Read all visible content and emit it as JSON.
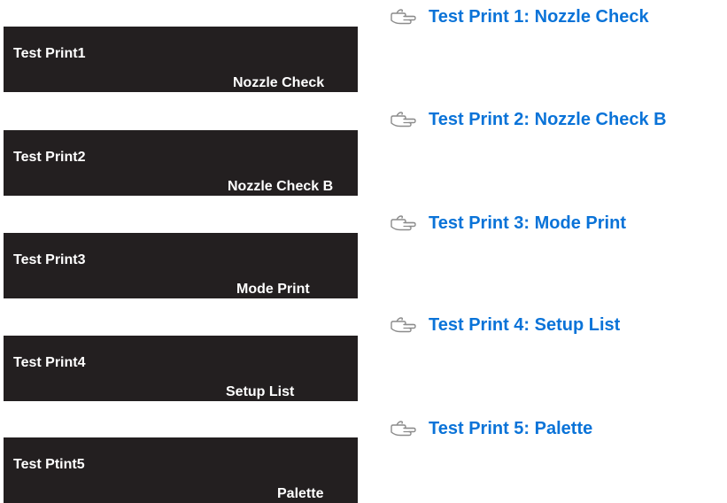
{
  "panels": [
    {
      "title": "Test Print1",
      "value": "Nozzle Check"
    },
    {
      "title": "Test Print2",
      "value": "Nozzle Check B"
    },
    {
      "title": "Test Print3",
      "value": "Mode Print"
    },
    {
      "title": "Test Print4",
      "value": "Setup List"
    },
    {
      "title": "Test Ptint5",
      "value": "Palette"
    }
  ],
  "links": [
    {
      "icon": "pointing-hand-icon",
      "label": "Test Print 1: Nozzle Check"
    },
    {
      "icon": "pointing-hand-icon",
      "label": "Test Print 2: Nozzle Check B"
    },
    {
      "icon": "pointing-hand-icon",
      "label": "Test Print 3: Mode Print"
    },
    {
      "icon": "pointing-hand-icon",
      "label": "Test Print 4: Setup List"
    },
    {
      "icon": "pointing-hand-icon",
      "label": "Test Print 5: Palette"
    }
  ],
  "colors": {
    "panel_background": "#231f20",
    "panel_text": "#ffffff",
    "link": "#0a73d8",
    "icon_stroke": "#8c8c8c"
  }
}
